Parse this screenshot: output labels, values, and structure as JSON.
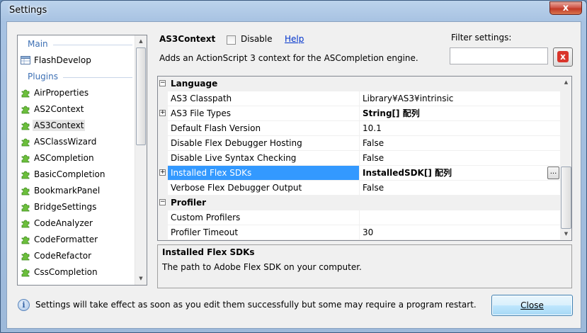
{
  "window": {
    "title": "Settings",
    "close_glyph": "x"
  },
  "sidebar": {
    "sections": [
      {
        "label": "Main",
        "items": [
          {
            "label": "FlashDevelop",
            "icon": "settings-grid-icon"
          }
        ]
      },
      {
        "label": "Plugins",
        "items": [
          {
            "label": "AirProperties",
            "icon": "plugin-icon"
          },
          {
            "label": "AS2Context",
            "icon": "plugin-icon"
          },
          {
            "label": "AS3Context",
            "icon": "plugin-icon",
            "selected": true
          },
          {
            "label": "ASClassWizard",
            "icon": "plugin-icon"
          },
          {
            "label": "ASCompletion",
            "icon": "plugin-icon"
          },
          {
            "label": "BasicCompletion",
            "icon": "plugin-icon"
          },
          {
            "label": "BookmarkPanel",
            "icon": "plugin-icon"
          },
          {
            "label": "BridgeSettings",
            "icon": "plugin-icon"
          },
          {
            "label": "CodeAnalyzer",
            "icon": "plugin-icon"
          },
          {
            "label": "CodeFormatter",
            "icon": "plugin-icon"
          },
          {
            "label": "CodeRefactor",
            "icon": "plugin-icon"
          },
          {
            "label": "CssCompletion",
            "icon": "plugin-icon"
          }
        ]
      }
    ]
  },
  "header": {
    "plugin_name": "AS3Context",
    "disable_label": "Disable",
    "disable_checked": false,
    "help_label": "Help",
    "description": "Adds an ActionScript 3 context for the ASCompletion engine."
  },
  "filter": {
    "label": "Filter settings:",
    "value": "",
    "clear_glyph": "x"
  },
  "grid": {
    "rows": [
      {
        "type": "category",
        "name": "Language",
        "expander": "−"
      },
      {
        "type": "prop",
        "name": "AS3 Classpath",
        "value": "Library¥AS3¥intrinsic"
      },
      {
        "type": "prop",
        "name": "AS3 File Types",
        "value": "String[] 配列",
        "bold": true,
        "expander": "+"
      },
      {
        "type": "prop",
        "name": "Default Flash Version",
        "value": "10.1"
      },
      {
        "type": "prop",
        "name": "Disable Flex Debugger Hosting",
        "value": "False"
      },
      {
        "type": "prop",
        "name": "Disable Live Syntax Checking",
        "value": "False"
      },
      {
        "type": "prop",
        "name": "Installed Flex SDKs",
        "value": "InstalledSDK[] 配列",
        "bold": true,
        "expander": "+",
        "selected": true,
        "ellipsis": "..."
      },
      {
        "type": "prop",
        "name": "Verbose Flex Debugger Output",
        "value": "False"
      },
      {
        "type": "category",
        "name": "Profiler",
        "expander": "−"
      },
      {
        "type": "prop",
        "name": "Custom Profilers",
        "value": ""
      },
      {
        "type": "prop",
        "name": "Profiler Timeout",
        "value": "30"
      }
    ]
  },
  "description_pane": {
    "title": "Installed Flex SDKs",
    "text": "The path to Adobe Flex SDK on your computer."
  },
  "footer": {
    "info_glyph": "i",
    "message": "Settings will take effect as soon as you edit them successfully but some may require a program restart.",
    "close_label": "Close"
  }
}
